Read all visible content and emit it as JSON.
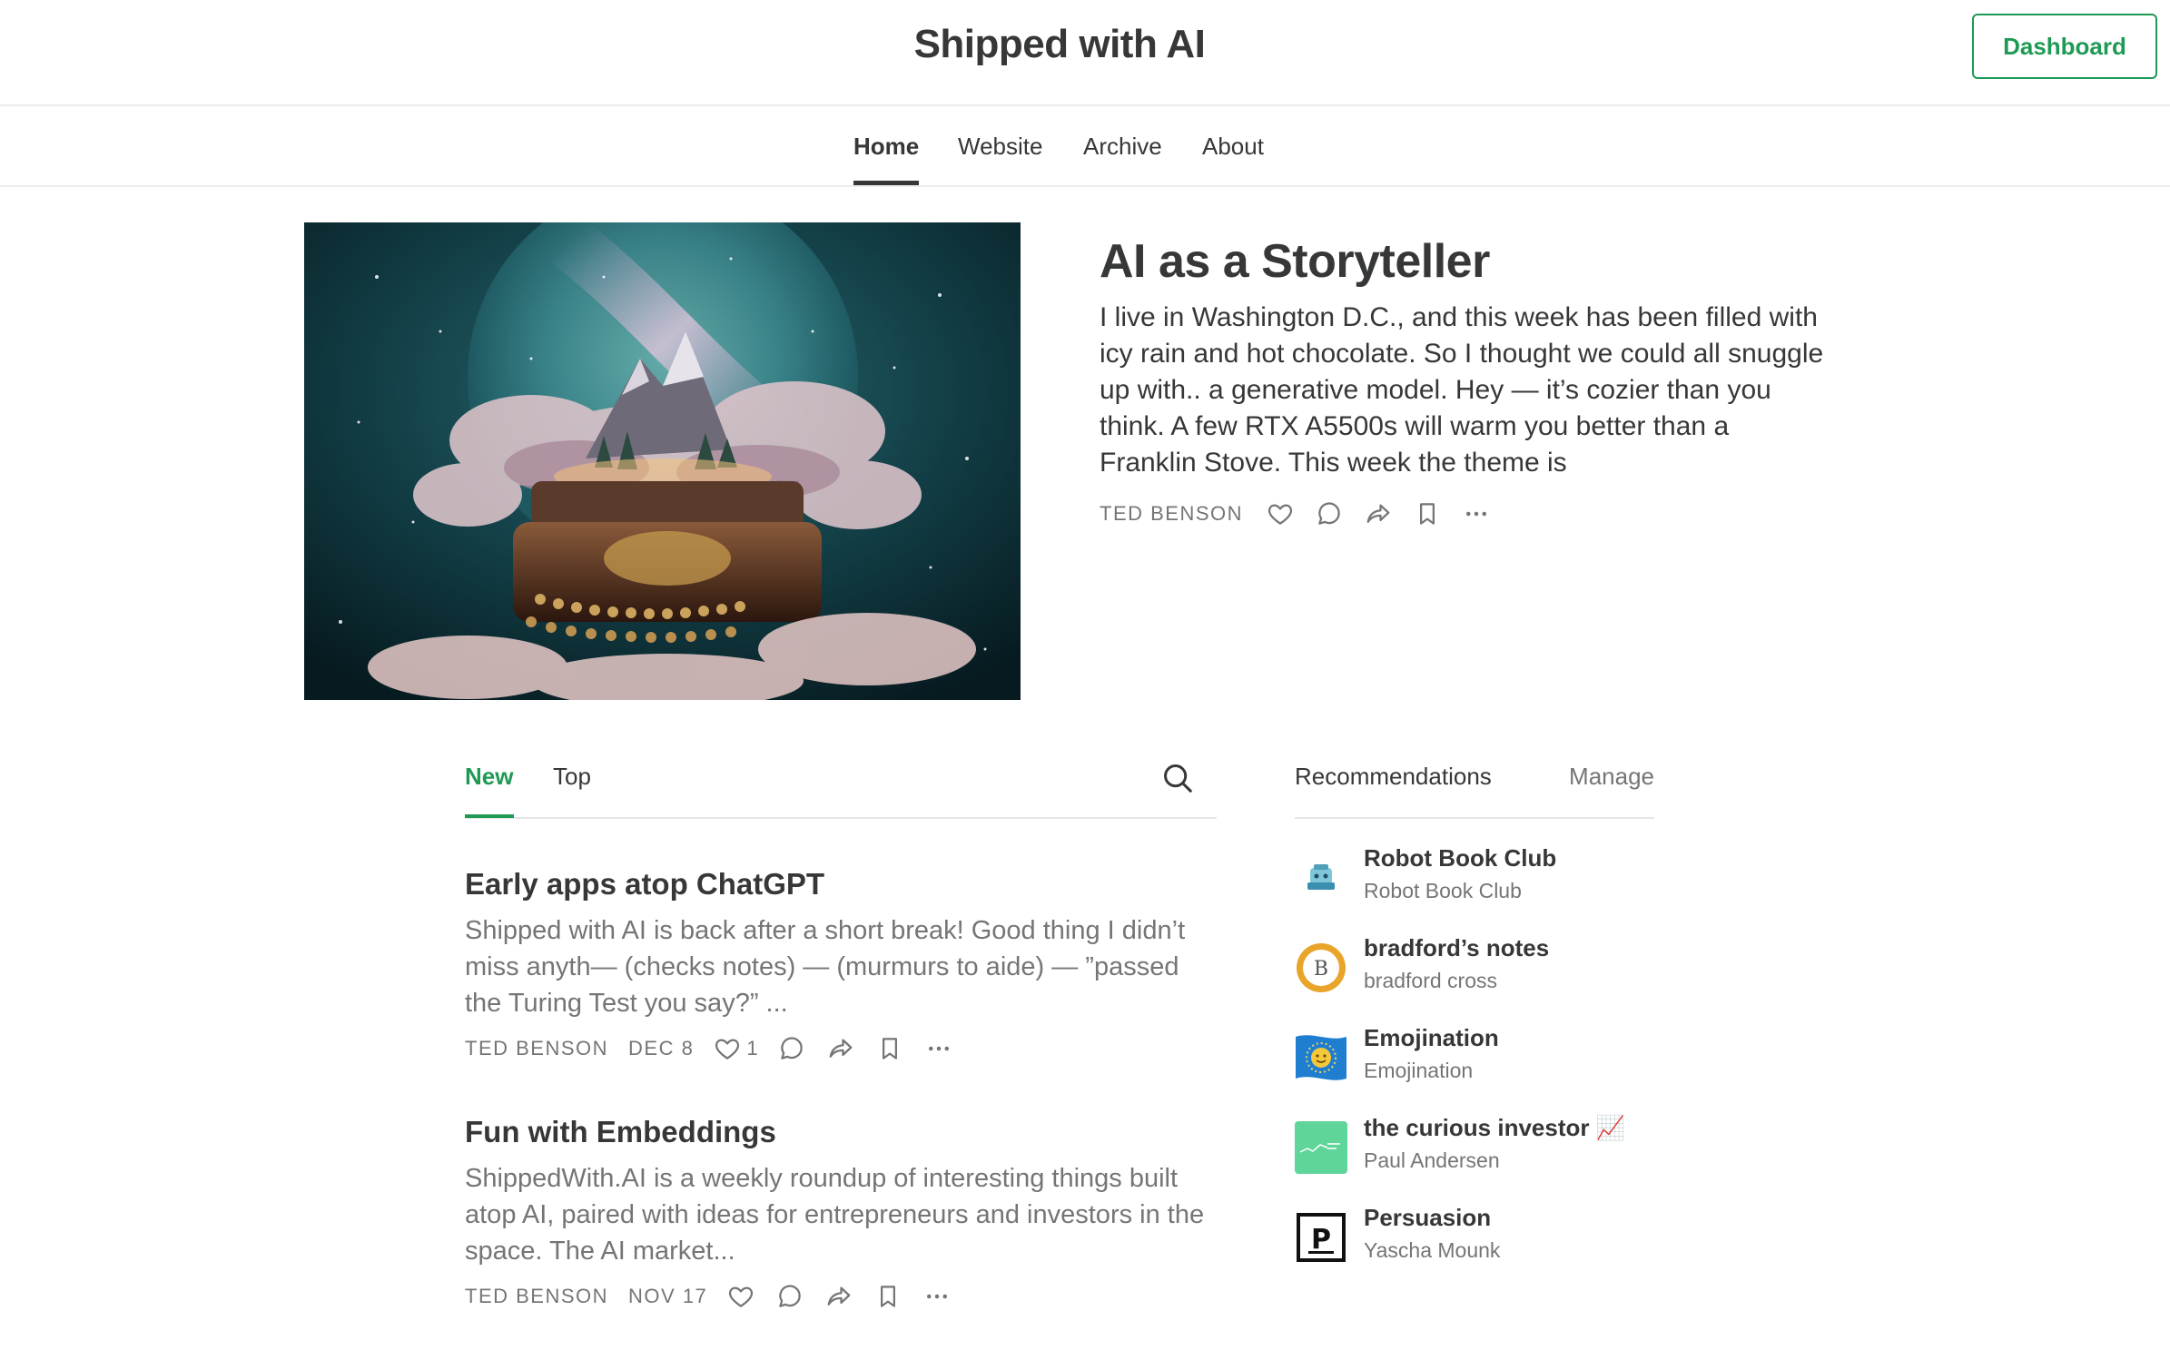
{
  "header": {
    "site_title": "Shipped with AI",
    "dashboard_label": "Dashboard"
  },
  "nav": {
    "items": [
      "Home",
      "Website",
      "Archive",
      "About"
    ],
    "active": "Home"
  },
  "featured": {
    "title": "AI as a Storyteller",
    "description": "I live in Washington D.C., and this week has been filled with icy rain and hot chocolate. So I thought we could all snuggle up with.. a generative model. Hey — it’s cozier than you think. A few RTX A5500s will warm you better than a Franklin Stove. This week the theme is",
    "author": "TED BENSON",
    "image_icon": "typewriter-in-clouds-illustration"
  },
  "feed": {
    "tabs": [
      "New",
      "Top"
    ],
    "active_tab": "New",
    "posts": [
      {
        "title": "Early apps atop ChatGPT",
        "description": "Shipped with AI is back after a short break! Good thing I didn’t miss anyth— (checks notes) — (murmurs to aide) — ”passed the Turing Test you say?” ...",
        "author": "TED BENSON",
        "date": "DEC 8",
        "likes": "1"
      },
      {
        "title": "Fun with Embeddings",
        "description": "ShippedWith.AI is a weekly roundup of interesting things built atop AI, paired with ideas for entrepreneurs and investors in the space. The AI market...",
        "author": "TED BENSON",
        "date": "NOV 17",
        "likes": ""
      }
    ]
  },
  "recommendations": {
    "title": "Recommendations",
    "manage_label": "Manage",
    "items": [
      {
        "name": "Robot Book Club",
        "author": "Robot Book Club",
        "icon": "robot-book-club-logo"
      },
      {
        "name": "bradford’s notes",
        "author": "bradford cross",
        "icon": "bradford-notes-logo"
      },
      {
        "name": "Emojination",
        "author": "Emojination",
        "icon": "emojination-flag-logo"
      },
      {
        "name": "the curious investor 📈",
        "author": "Paul Andersen",
        "icon": "curious-investor-logo"
      },
      {
        "name": "Persuasion",
        "author": "Yascha Mounk",
        "icon": "persuasion-logo"
      }
    ]
  },
  "colors": {
    "accent": "#1f9a55",
    "text": "#363737",
    "muted": "#757575"
  }
}
